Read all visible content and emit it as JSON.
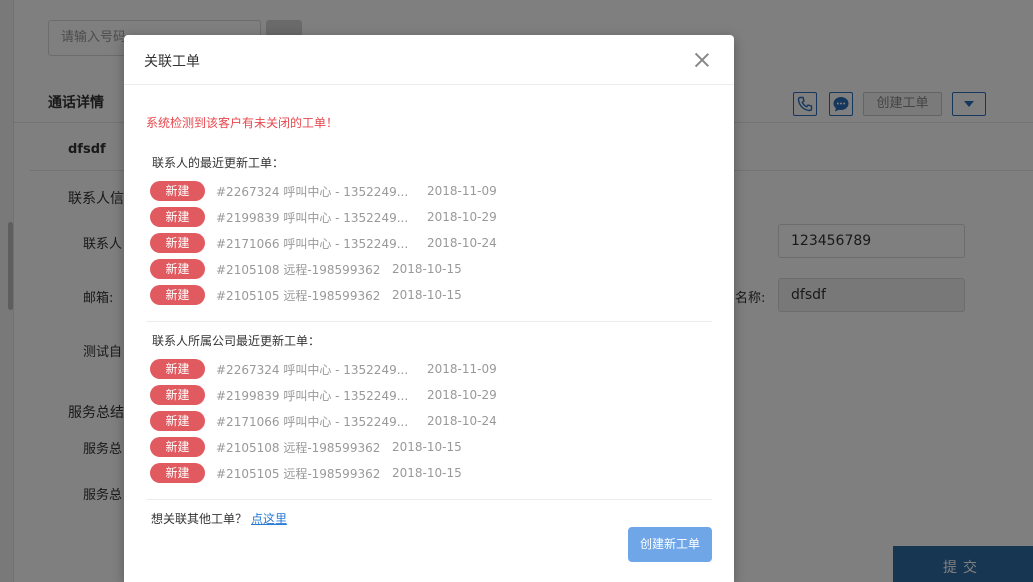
{
  "background": {
    "search_placeholder": "请输入号码",
    "section_title": "通话详情",
    "tab_label": "dfsdf",
    "group_contact": "联系人信",
    "label_contact_name": "联系人",
    "label_email": "邮箱:",
    "label_test": "测试自",
    "group_service": "服务总结",
    "label_service1": "服务总",
    "label_service2": "服务总",
    "label_company_name": "名称:",
    "phone_value": "123456789",
    "company_value": "dfsdf",
    "create_ticket_label": "创建工单",
    "submit_label": "提交"
  },
  "modal": {
    "title": "关联工单",
    "warning": "系统检测到该客户有未关闭的工单！",
    "contact_section_title": "联系人的最近更新工单：",
    "company_section_title": "联系人所属公司最近更新工单：",
    "contact_tickets": [
      {
        "status": "新建",
        "title": "#2267324 呼叫中心 - 1352249...",
        "date": "2018-11-09"
      },
      {
        "status": "新建",
        "title": "#2199839 呼叫中心 - 1352249...",
        "date": "2018-10-29"
      },
      {
        "status": "新建",
        "title": "#2171066 呼叫中心 - 1352249...",
        "date": "2018-10-24"
      },
      {
        "status": "新建",
        "title": "#2105108 远程-198599362",
        "date": "2018-10-15"
      },
      {
        "status": "新建",
        "title": "#2105105 远程-198599362",
        "date": "2018-10-15"
      }
    ],
    "company_tickets": [
      {
        "status": "新建",
        "title": "#2267324 呼叫中心 - 1352249...",
        "date": "2018-11-09"
      },
      {
        "status": "新建",
        "title": "#2199839 呼叫中心 - 1352249...",
        "date": "2018-10-29"
      },
      {
        "status": "新建",
        "title": "#2171066 呼叫中心 - 1352249...",
        "date": "2018-10-24"
      },
      {
        "status": "新建",
        "title": "#2105108 远程-198599362",
        "date": "2018-10-15"
      },
      {
        "status": "新建",
        "title": "#2105105 远程-198599362",
        "date": "2018-10-15"
      }
    ],
    "footer_question": "想关联其他工单？",
    "footer_link": "点这里",
    "create_button": "创建新工单"
  },
  "colors": {
    "badge": "#e05a5f",
    "warning": "#e8474d",
    "primary_button": "#6ea6e8",
    "link": "#2a7bd3"
  }
}
